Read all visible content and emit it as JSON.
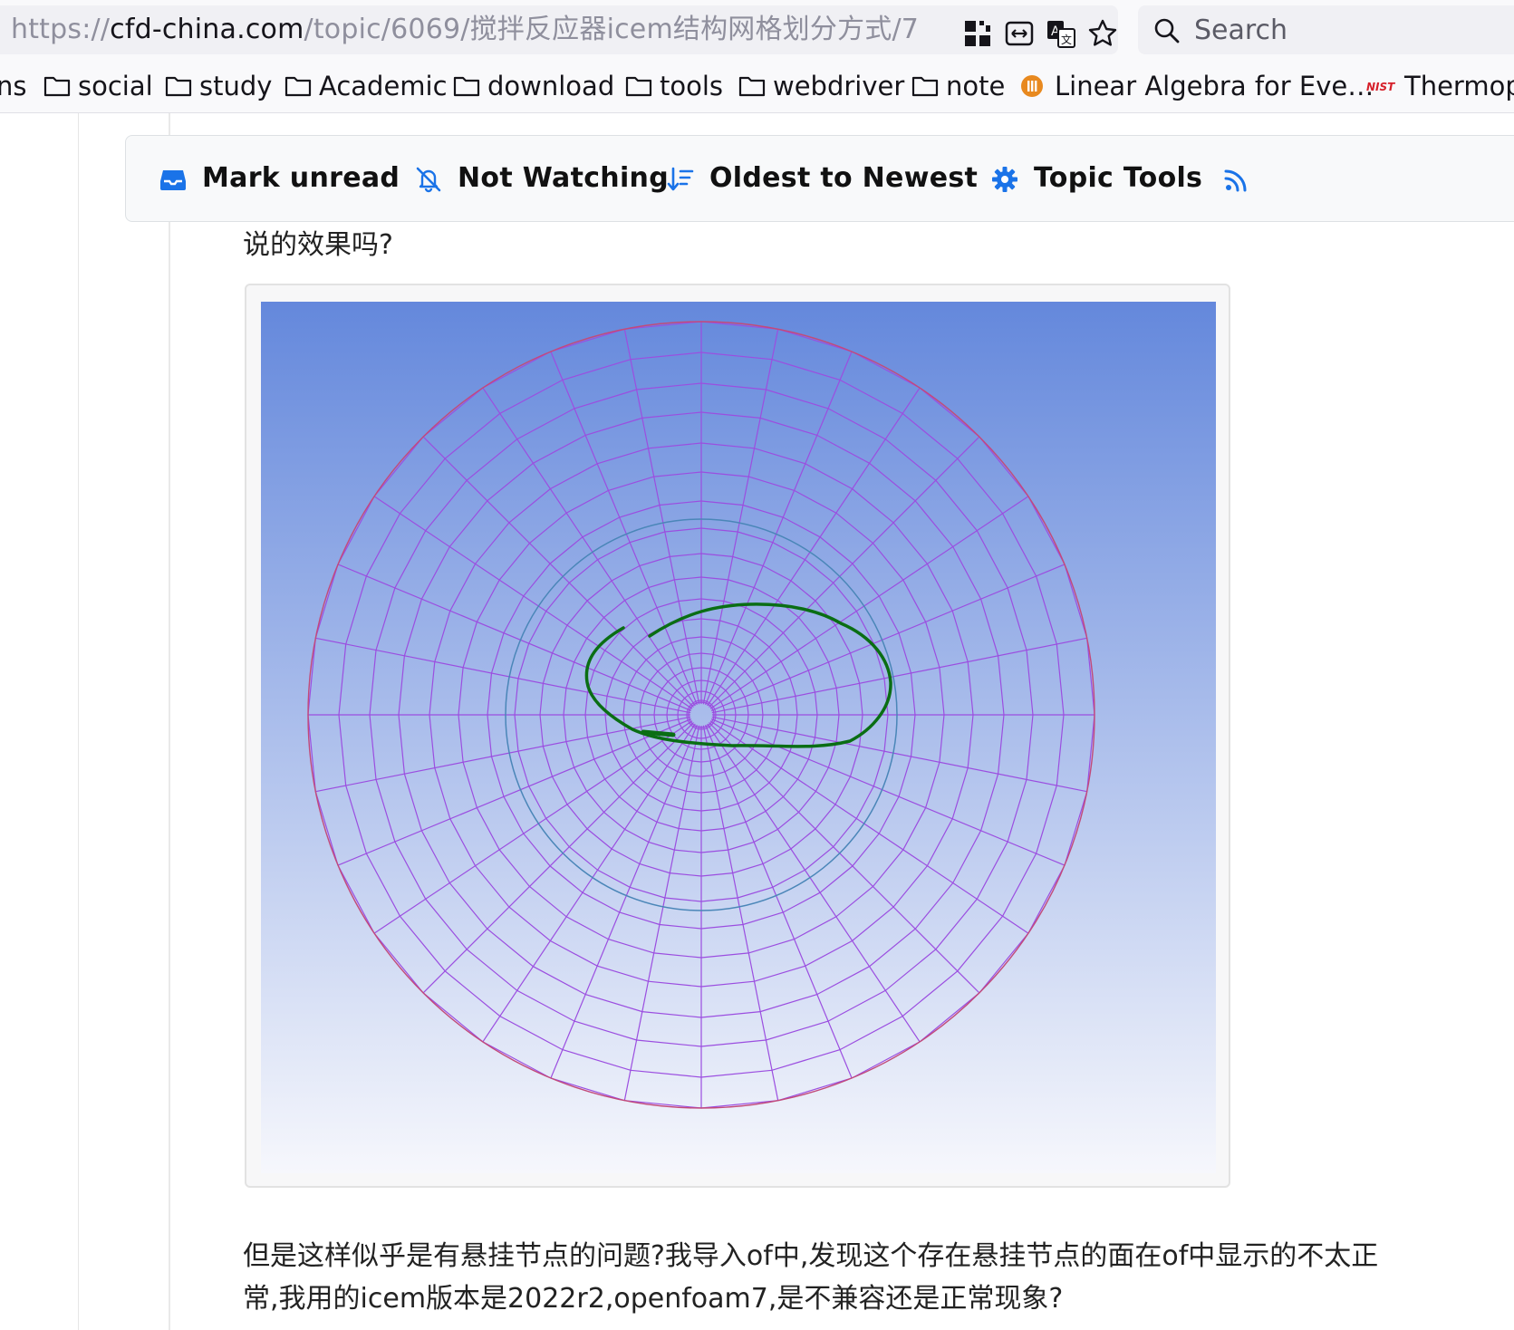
{
  "browser": {
    "url": {
      "scheme": "https://",
      "host": "cfd-china.com",
      "path": "/topic/6069/搅拌反应器icem结构网格划分方式/7"
    },
    "url_icons": [
      "qr-code-icon",
      "reader-view-icon",
      "translate-icon",
      "bookmark-star-icon"
    ],
    "search_placeholder": "Search",
    "bookmarks": [
      {
        "label": "ns",
        "icon": "none"
      },
      {
        "label": "social",
        "icon": "folder-icon"
      },
      {
        "label": "study",
        "icon": "folder-icon"
      },
      {
        "label": "Academic",
        "icon": "folder-icon"
      },
      {
        "label": "download",
        "icon": "folder-icon"
      },
      {
        "label": "tools",
        "icon": "folder-icon"
      },
      {
        "label": "webdriver",
        "icon": "folder-icon"
      },
      {
        "label": "note",
        "icon": "folder-icon"
      },
      {
        "label": "Linear Algebra for Eve…",
        "icon": "site-favicon-icon"
      },
      {
        "label": "Thermopl",
        "icon": "nist-favicon-icon"
      }
    ]
  },
  "toolbar": {
    "mark_unread": "Mark unread",
    "not_watching": "Not Watching",
    "sort": "Oldest to Newest",
    "topic_tools": "Topic Tools",
    "accent": "#1a73e8"
  },
  "post": {
    "intro": "说的效果吗?",
    "body_line1": "但是这样似乎是有悬挂节点的问题?我导入of中,发现这个存在悬挂节点的面在of中显示的不太正",
    "body_line2": "常,我用的icem版本是2022r2,openfoam7,是不兼容还是正常现象?"
  },
  "colors": {
    "mesh_line": "#9b4ee0",
    "circle_outline": "#4a86b8",
    "annotation": "#0a6e14",
    "bg_top": "#6488dc",
    "bg_bottom": "#f6f7fc"
  }
}
